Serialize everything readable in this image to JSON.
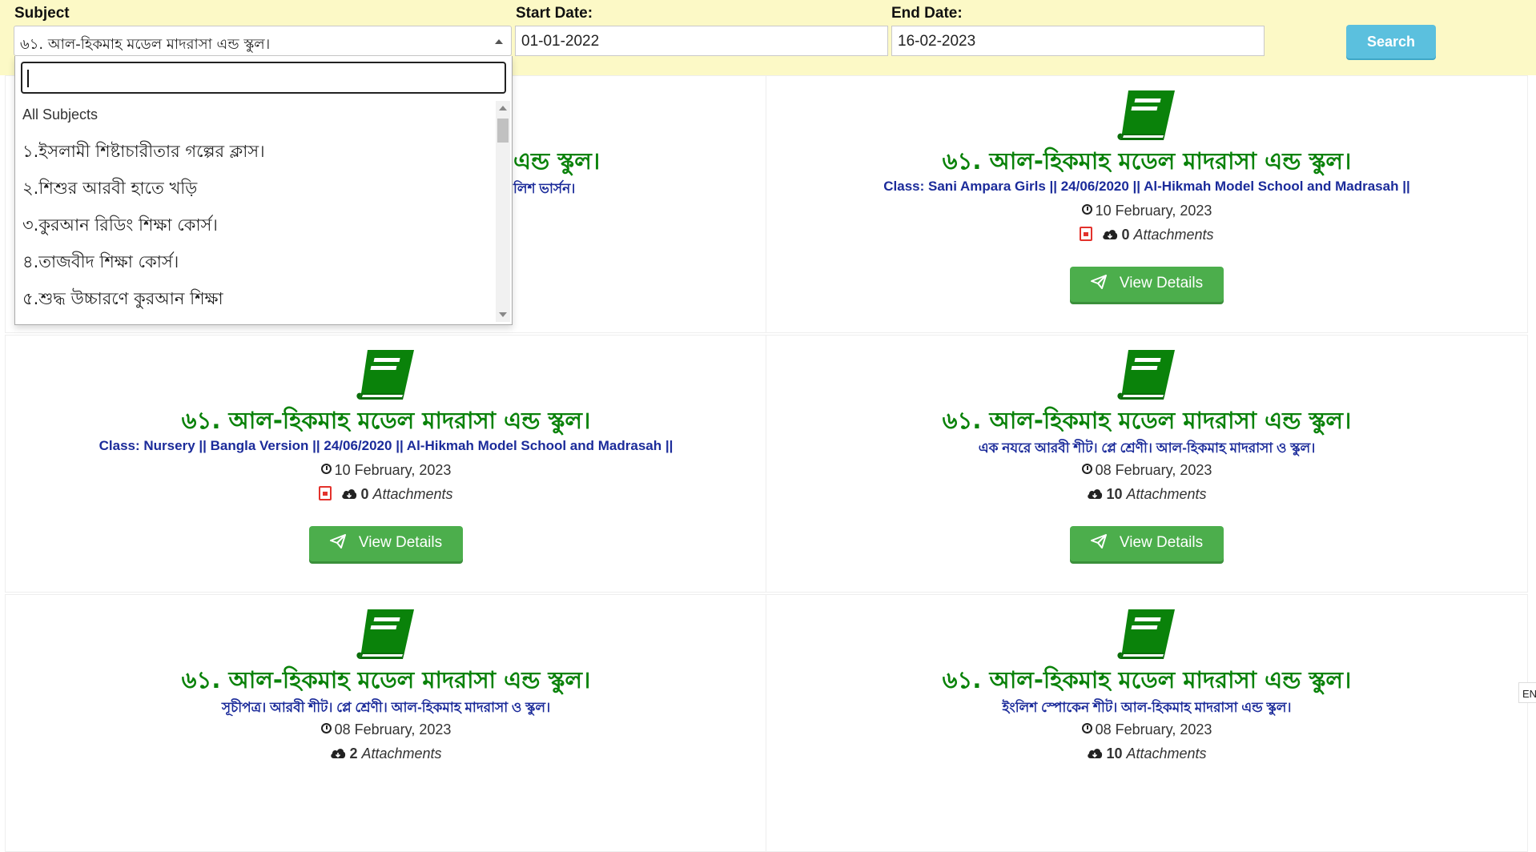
{
  "filters": {
    "subject_label": "Subject",
    "subject_value": "৬১. আল-হিকমাহ মডেল মাদরাসা এন্ড স্কুল।",
    "start_label": "Start Date:",
    "start_value": "01-01-2022",
    "end_label": "End Date:",
    "end_value": "16-02-2023",
    "search_label": "Search"
  },
  "dropdown": {
    "search_value": "",
    "items": [
      "All Subjects",
      "১.ইসলামী শিষ্টাচারীতার গল্পের ক্লাস।",
      "২.শিশুর আরবী হাতে খড়ি",
      "৩.কুরআন রিডিং শিক্ষা কোর্স।",
      "৪.তাজবীদ শিক্ষা কোর্স।",
      "৫.শুদ্ধ উচ্চারণে কুরআন শিক্ষা"
    ]
  },
  "colors": {
    "title": "#0a820a",
    "subtitle": "#1b2b9a",
    "button": "#4cae4c",
    "search": "#5bc0de",
    "filter_bg": "#fcf9c6"
  },
  "cards": [
    {
      "title": "এন্ড স্কুল।",
      "subtitle": "লিশ ভার্সন।",
      "date": "",
      "count": "",
      "attach_word": "",
      "button": ""
    },
    {
      "title": "৬১. আল-হিকমাহ মডেল মাদরাসা এন্ড স্কুল।",
      "subtitle": "Class: Sani Ampara Girls || 24/06/2020 || Al-Hikmah Model School and Madrasah ||",
      "date": "10 February, 2023",
      "count": "0",
      "attach_word": "Attachments",
      "button": "View Details"
    },
    {
      "title": "৬১. আল-হিকমাহ মডেল মাদরাসা এন্ড স্কুল।",
      "subtitle": "Class: Nursery || Bangla Version || 24/06/2020 || Al-Hikmah Model School and Madrasah ||",
      "date": "10 February, 2023",
      "count": "0",
      "attach_word": "Attachments",
      "button": "View Details"
    },
    {
      "title": "৬১. আল-হিকমাহ মডেল মাদরাসা এন্ড স্কুল।",
      "subtitle": "এক নযরে আরবী শীট। প্লে শ্রেণী। আল-হিকমাহ মাদরাসা ও স্কুল।",
      "date": "08 February, 2023",
      "count": "10",
      "attach_word": "Attachments",
      "button": "View Details"
    },
    {
      "title": "৬১. আল-হিকমাহ মডেল মাদরাসা এন্ড স্কুল।",
      "subtitle": "সূচীপত্র। আরবী শীট। প্লে শ্রেণী। আল-হিকমাহ মাদরাসা ও স্কুল।",
      "date": "08 February, 2023",
      "count": "2",
      "attach_word": "Attachments",
      "button": ""
    },
    {
      "title": "৬১. আল-হিকমাহ মডেল মাদরাসা এন্ড স্কুল।",
      "subtitle": "ইংলিশ স্পোকেন শীট। আল-হিকমাহ মাদরাসা এন্ড স্কুল।",
      "date": "08 February, 2023",
      "count": "10",
      "attach_word": "Attachments",
      "button": ""
    }
  ],
  "edge_tab": "EN"
}
